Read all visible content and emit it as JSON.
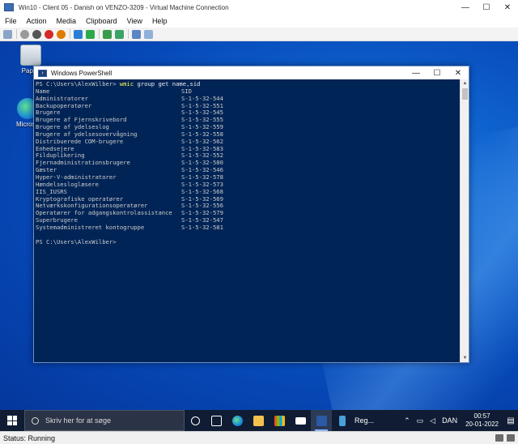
{
  "vm_window": {
    "title": "Win10 - Client 05 - Danish on VENZO-3209 - Virtual Machine Connection",
    "minimize": "—",
    "maximize": "☐",
    "close": "✕"
  },
  "menubar": [
    "File",
    "Action",
    "Media",
    "Clipboard",
    "View",
    "Help"
  ],
  "desktop": {
    "icons": [
      {
        "label": "Papirk"
      },
      {
        "label": "Microso"
      }
    ]
  },
  "powershell": {
    "title": "Windows PowerShell",
    "minimize": "—",
    "maximize": "☐",
    "close": "✕",
    "prompt": "PS C:\\Users\\AlexWilber> ",
    "command": "wmic",
    "command_args": " group get name,sid",
    "columns": [
      "Name",
      "SID"
    ],
    "rows": [
      [
        "Administratorer",
        "S-1-5-32-544"
      ],
      [
        "Backupoperatører",
        "S-1-5-32-551"
      ],
      [
        "Brugere",
        "S-1-5-32-545"
      ],
      [
        "Brugere af Fjernskrivebord",
        "S-1-5-32-555"
      ],
      [
        "Brugere af ydelseslog",
        "S-1-5-32-559"
      ],
      [
        "Brugere af ydelsesovervågning",
        "S-1-5-32-558"
      ],
      [
        "Distribuerede COM-brugere",
        "S-1-5-32-562"
      ],
      [
        "Enhedsejere",
        "S-1-5-32-583"
      ],
      [
        "Filduplikering",
        "S-1-5-32-552"
      ],
      [
        "Fjernadministrationsbrugere",
        "S-1-5-32-580"
      ],
      [
        "Gæster",
        "S-1-5-32-546"
      ],
      [
        "Hyper-V-administratorer",
        "S-1-5-32-578"
      ],
      [
        "Hændelsesloglæsere",
        "S-1-5-32-573"
      ],
      [
        "IIS_IUSRS",
        "S-1-5-32-568"
      ],
      [
        "Kryptografiske operatører",
        "S-1-5-32-569"
      ],
      [
        "Netværkskonfigurationsoperatører",
        "S-1-5-32-556"
      ],
      [
        "Operatører for adgangskontrolassistance",
        "S-1-5-32-579"
      ],
      [
        "Superbrugere",
        "S-1-5-32-547"
      ],
      [
        "Systemadministreret kontogruppe",
        "S-1-5-32-581"
      ]
    ],
    "final_prompt": "PS C:\\Users\\AlexWilber>"
  },
  "taskbar": {
    "search_placeholder": "Skriv her for at søge",
    "regedit_label": "Reg...",
    "language": "DAN",
    "time": "00:57",
    "date": "20-01-2022"
  },
  "statusbar": {
    "status": "Status: Running"
  },
  "colors": {
    "console_bg": "#012456",
    "console_fg": "#cccccc",
    "command": "#ffff55",
    "taskbar": "#101c33"
  }
}
